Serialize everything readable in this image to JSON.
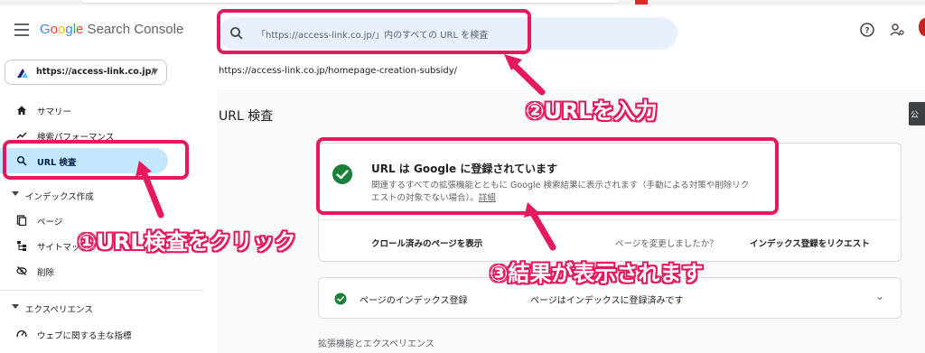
{
  "app": {
    "logo": {
      "g": "G",
      "o1": "o",
      "o2": "o",
      "g2": "g",
      "l": "l",
      "e": "e",
      "rest": " Search Console"
    }
  },
  "header": {
    "search_placeholder": "「https://access-link.co.jp/」内のすべての URL を検査"
  },
  "property": {
    "label": "https://access-link.co.jp/"
  },
  "inspected_url": "https://access-link.co.jp/homepage-creation-subsidy/",
  "sidebar": {
    "items": [
      {
        "label": "サマリー",
        "icon": "home-icon"
      },
      {
        "label": "検索パフォーマンス",
        "icon": "trending-up-icon"
      },
      {
        "label": "URL 検査",
        "icon": "search-icon"
      }
    ],
    "index_section": {
      "label": "インデックス作成",
      "items": [
        {
          "label": "ページ",
          "icon": "pages-icon"
        },
        {
          "label": "サイトマップ",
          "icon": "sitemap-icon"
        },
        {
          "label": "削除",
          "icon": "removals-icon"
        }
      ]
    },
    "experience_section": {
      "label": "エクスペリエンス",
      "items": [
        {
          "label": "ウェブに関する主な指標",
          "icon": "speed-icon"
        }
      ]
    }
  },
  "main": {
    "title": "URL 検査",
    "side_tab": "公",
    "result_card": {
      "title": "URL は Google に登録されています",
      "description": "関連するすべての拡張機能とともに Google 検索結果に表示されます（手動による対策や削除リクエストの対象でない場合）。",
      "details_link": "詳細",
      "crawled_link": "クロール済みのページを表示",
      "changed_question": "ページを変更しましたか？",
      "request_indexing": "インデックス登録をリクエスト"
    },
    "index_card": {
      "label": "ページのインデックス登録",
      "status": "ページはインデックスに登録済みです"
    },
    "section_label": "拡張機能とエクスペリエンス"
  },
  "annotations": {
    "step1": "①URL検査をクリック",
    "step2": "②URLを入力",
    "step3": "③結果が表示されます",
    "color": "#e6195c"
  },
  "colors": {
    "accent": "#1a73e8",
    "active_nav": "#c2e7ff",
    "success": "#188038",
    "search_bg": "#e8f0fe"
  }
}
